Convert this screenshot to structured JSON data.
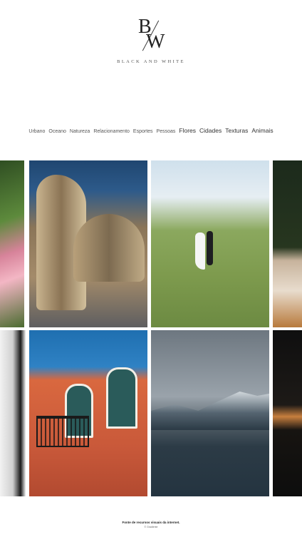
{
  "logo": {
    "initial_b": "B",
    "initial_w": "W",
    "text": "BLACK AND WHITE"
  },
  "nav": {
    "items": [
      "Urbano",
      "Oceano",
      "Natureza",
      "Relacionamento",
      "Esportes",
      "Pessoas",
      "Flores",
      "Cidades",
      "Texturas",
      "Animais"
    ]
  },
  "footer": {
    "credit": "Fonte de recursos visuais da internet.",
    "copyright": "© Gradiente"
  },
  "colors": {
    "background": "#ffffff",
    "text": "#222222"
  }
}
